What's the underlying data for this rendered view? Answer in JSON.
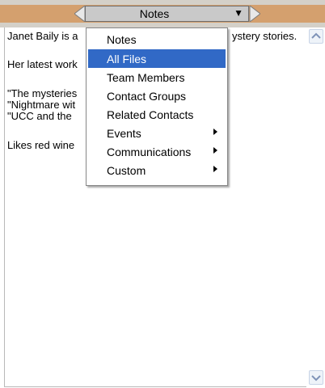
{
  "toolbar": {
    "view_label": "Notes",
    "prev_icon": "chevron-left-icon",
    "next_icon": "chevron-right-icon",
    "dropdown_icon": "triangle-down-icon",
    "colors": {
      "accent": "#d4a06e",
      "bar": "#d4d0c8"
    }
  },
  "note": {
    "line1_start": "Janet Baily is a",
    "line1_end": "ystery stories.",
    "line2": "Her latest work",
    "line3": "\"The mysteries",
    "line4": "\"Nightmare wit",
    "line5": "\"UCC and the",
    "line6": "Likes red wine"
  },
  "menu": {
    "items": [
      {
        "label": "Notes",
        "submenu": false
      },
      {
        "label": "All Files",
        "submenu": false,
        "selected": true
      },
      {
        "label": "Team Members",
        "submenu": false
      },
      {
        "label": "Contact Groups",
        "submenu": false
      },
      {
        "label": "Related Contacts",
        "submenu": false
      },
      {
        "label": "Events",
        "submenu": true
      },
      {
        "label": "Communications",
        "submenu": true
      },
      {
        "label": "Custom",
        "submenu": true
      }
    ],
    "selected_color": "#3169c6"
  },
  "scrollbar": {
    "up_icon": "scroll-up-icon",
    "down_icon": "scroll-down-icon"
  }
}
